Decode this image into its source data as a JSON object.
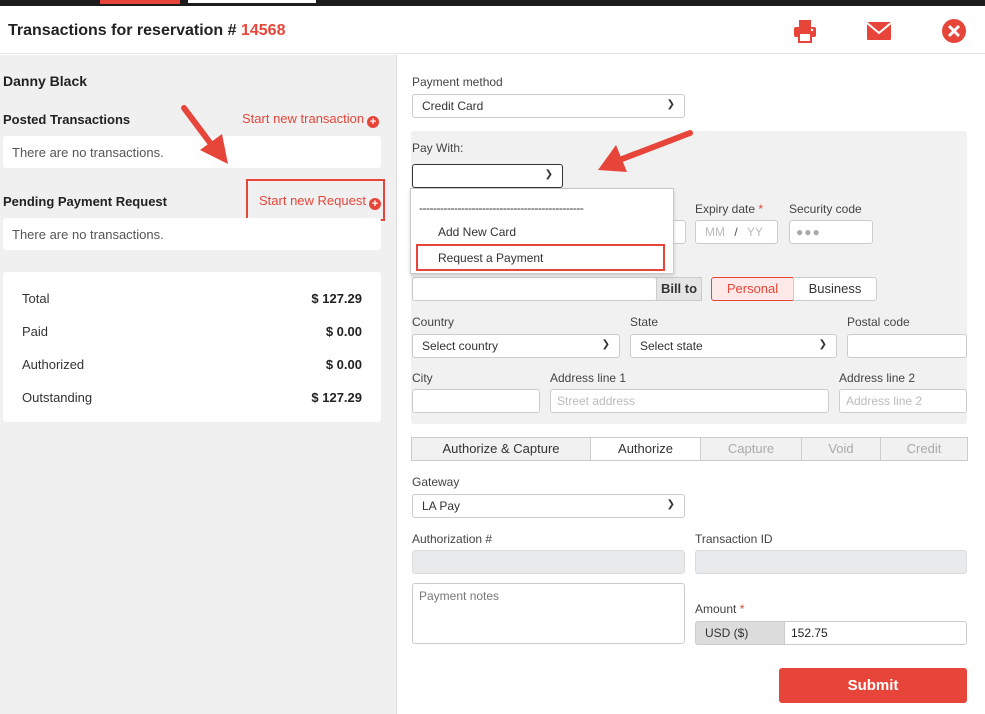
{
  "header": {
    "title": "Transactions for reservation #",
    "reservation_number": "14568",
    "icons": [
      "print-icon",
      "email-icon",
      "close-icon"
    ]
  },
  "left": {
    "guest_name": "Danny Black",
    "posted": {
      "title": "Posted Transactions",
      "link": "Start new transaction",
      "empty": "There are no transactions."
    },
    "pending": {
      "title": "Pending Payment Request",
      "link": "Start new Request",
      "empty": "There are no transactions."
    },
    "totals": [
      {
        "label": "Total",
        "value": "$ 127.29"
      },
      {
        "label": "Paid",
        "value": "$ 0.00"
      },
      {
        "label": "Authorized",
        "value": "$ 0.00"
      },
      {
        "label": "Outstanding",
        "value": "$ 127.29"
      }
    ]
  },
  "form": {
    "payment_method": {
      "label": "Payment method",
      "value": "Credit Card"
    },
    "pay_with": {
      "label": "Pay With:",
      "value": "",
      "options": [
        "-----------------------------------------------",
        "Add New Card",
        "Request a Payment"
      ]
    },
    "expiry": {
      "label": "Expiry date",
      "mm": "MM",
      "slash": "/",
      "yy": "YY"
    },
    "security": {
      "label": "Security code",
      "placeholder": "●●●"
    },
    "bill_to": {
      "label": "Bill to",
      "personal": "Personal",
      "business": "Business"
    },
    "country": {
      "label": "Country",
      "value": "Select country"
    },
    "state": {
      "label": "State",
      "value": "Select state"
    },
    "postal": {
      "label": "Postal code"
    },
    "city": {
      "label": "City"
    },
    "address1": {
      "label": "Address line 1",
      "placeholder": "Street address"
    },
    "address2": {
      "label": "Address line 2",
      "placeholder": "Address line 2"
    },
    "tabs": [
      "Authorize & Capture",
      "Authorize",
      "Capture",
      "Void",
      "Credit"
    ],
    "gateway": {
      "label": "Gateway",
      "value": "LA Pay"
    },
    "authorization": {
      "label": "Authorization #"
    },
    "transaction_id": {
      "label": "Transaction ID"
    },
    "notes": {
      "placeholder": "Payment notes"
    },
    "amount": {
      "label": "Amount",
      "currency": "USD ($)",
      "value": "152.75"
    },
    "submit": "Submit"
  },
  "colors": {
    "accent": "#e8453a",
    "panel": "#f0f0f0"
  }
}
